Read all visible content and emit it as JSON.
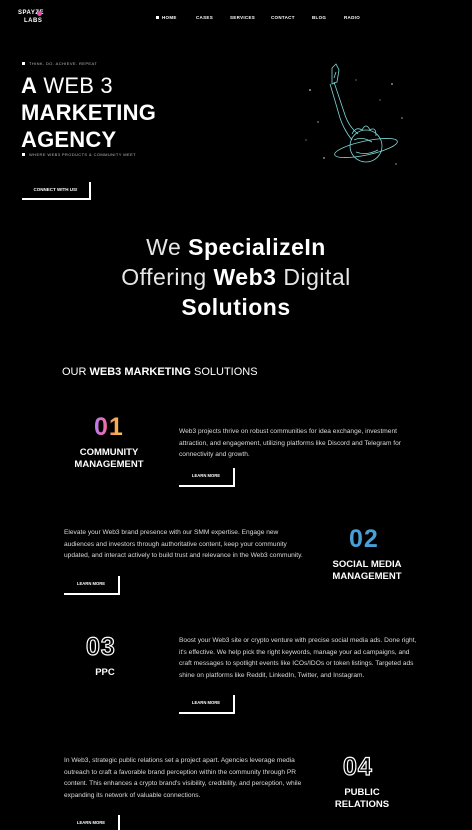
{
  "brand": {
    "line1": "SPAYZE",
    "line2": "LABS"
  },
  "nav": {
    "items": [
      "HOME",
      "CASES",
      "SERVICES",
      "CONTACT",
      "BLOG",
      "RADIO"
    ]
  },
  "hero": {
    "eyebrow": "THINK. DO. ACHIEVE. REPEAT",
    "title_a": "A",
    "title_web": " WEB 3",
    "title_line2": "MARKETING",
    "title_line3": "AGENCY",
    "tagline": "WHERE WEB3 PRODUCTS & COMMUNITY MEET",
    "cta": "CONNECT WITH US!"
  },
  "specialize": {
    "we": "We ",
    "specialize": "SpecializeIn",
    "offering": "Offering ",
    "web3": "Web3",
    "digital": " Digital",
    "solutions": "Solutions"
  },
  "solutions_heading": {
    "pre": "OUR ",
    "bold": "WEB3 MARKETING",
    "post": " SOLUTIONS"
  },
  "services": [
    {
      "number": "01",
      "name_l1": "COMMUNITY",
      "name_l2": "MANAGEMENT",
      "desc": "Web3 projects thrive on robust communities for idea exchange, investment attraction, and engagement, utilizing platforms like Discord and Telegram for connectivity and growth.",
      "button": "LEARN MORE"
    },
    {
      "number": "02",
      "name_l1": "SOCIAL MEDIA",
      "name_l2": "MANAGEMENT",
      "desc": "Elevate your Web3 brand presence with our SMM expertise. Engage new audiences and investors through authoritative content, keep your community updated, and interact actively to build trust and relevance in the Web3 community.",
      "button": "LEARN MORE"
    },
    {
      "number": "03",
      "name_l1": "PPC",
      "name_l2": "",
      "desc": "Boost your Web3 site or crypto venture with precise social media ads. Done right, it's effective. We help pick the right keywords, manage your ad campaigns, and craft messages to spotlight events like ICOs/IDOs or token listings. Targeted ads shine on platforms like Reddit, LinkedIn, Twitter, and Instagram.",
      "button": "LEARN MORE"
    },
    {
      "number": "04",
      "name_l1": "PUBLIC",
      "name_l2": "RELATIONS",
      "desc": "In Web3, strategic public relations set a project apart. Agencies leverage media outreach to craft a favorable brand perception within the community through PR content. This enhances a crypto brand's visibility, credibility, and perception, while expanding its network of valuable connections.",
      "button": "LEARN MORE"
    }
  ]
}
